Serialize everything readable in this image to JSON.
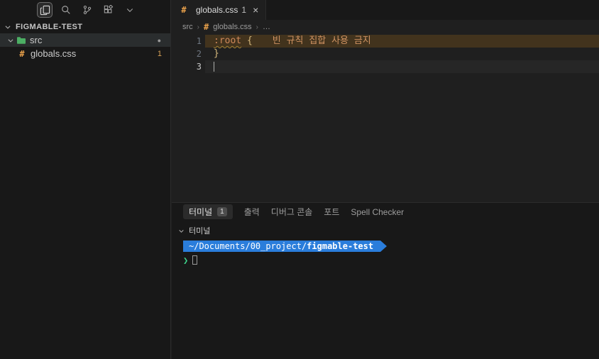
{
  "explorer": {
    "title": "FIGMABLE-TEST",
    "src_label": "src",
    "src_dot": "●",
    "file_label": "globals.css",
    "file_badge": "1"
  },
  "tab": {
    "label": "globals.css",
    "badge": "1",
    "close": "×"
  },
  "icons": {
    "css_hash": "#"
  },
  "breadcrumb": {
    "item1": "src",
    "sep1": "›",
    "item2": "globals.css",
    "sep2": "›",
    "item3": "…"
  },
  "code": {
    "line1_num": "1",
    "line1_selector": ":root",
    "line1_space": " ",
    "line1_brace": "{",
    "line1_message": "빈 규칙 집합 사용 금지",
    "line2_num": "2",
    "line2_text": "}",
    "line3_num": "3"
  },
  "panel": {
    "tab_terminal": "터미널",
    "tab_terminal_badge": "1",
    "tab_output": "출력",
    "tab_debug": "디버그 콘솔",
    "tab_ports": "포트",
    "tab_spell": "Spell Checker",
    "section_label": "터미널"
  },
  "terminal": {
    "path_prefix": "~/Documents/00_project/",
    "path_bold": "figmable-test",
    "prompt": "❯"
  },
  "colors": {
    "accent_blue": "#2a7ddb",
    "warning_orange": "#ce9261",
    "prompt_green": "#3dd68c",
    "line_highlight": "#42331d"
  }
}
